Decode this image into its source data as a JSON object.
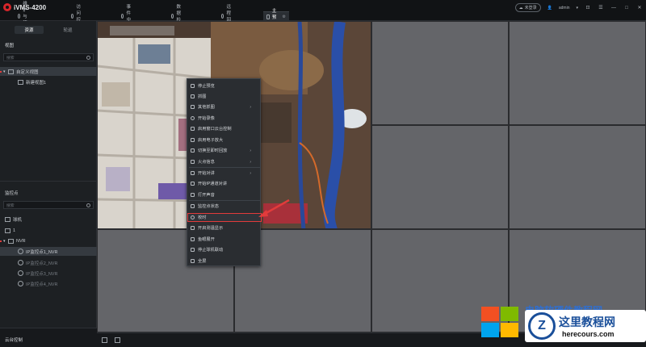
{
  "app": {
    "title": "iVMS-4200"
  },
  "nav_tabs": [
    {
      "label": "维护与管理"
    },
    {
      "label": "访问控制"
    },
    {
      "label": "事件中心"
    },
    {
      "label": "数据检索"
    },
    {
      "label": "远程回放"
    },
    {
      "label": "主预览"
    }
  ],
  "header": {
    "login_status": "未登录",
    "user": "admin"
  },
  "left_panel": {
    "tabs": [
      {
        "label": "资源"
      },
      {
        "label": "轮巡"
      }
    ],
    "views_title": "视图",
    "views_search_placeholder": "搜索",
    "views_tree": [
      {
        "label": "自定义视图"
      },
      {
        "label": "新建视图1"
      }
    ],
    "points_title": "监控点",
    "points_search_placeholder": "搜索",
    "points_tree": [
      {
        "label": "球机"
      },
      {
        "label": "1"
      },
      {
        "label": "NVR"
      },
      {
        "label": "IP监控点1_NVR"
      },
      {
        "label": "IP监控点2_NVR"
      },
      {
        "label": "IP监控点3_NVR"
      },
      {
        "label": "IP监控点4_NVR"
      }
    ],
    "ptz_title": "云台控制"
  },
  "context_menu": [
    {
      "label": "停止预览",
      "submenu": false
    },
    {
      "label": "抓图",
      "submenu": false
    },
    {
      "label": "其他抓图",
      "submenu": true
    },
    {
      "label": "开始录像",
      "submenu": false
    },
    {
      "label": "启用窗口云台控制",
      "submenu": false
    },
    {
      "label": "启用电子放大",
      "submenu": false
    },
    {
      "label": "切换至即时回放",
      "submenu": true
    },
    {
      "label": "火点信息",
      "submenu": true
    },
    {
      "label": "开始对讲",
      "submenu": true
    },
    {
      "label": "开始IP通道对讲",
      "submenu": false
    },
    {
      "label": "打开声音",
      "submenu": false
    },
    {
      "label": "监控点状态",
      "submenu": false
    },
    {
      "label": "校时",
      "submenu": false
    },
    {
      "label": "开启测温显示",
      "submenu": false
    },
    {
      "label": "鱼眼展开",
      "submenu": false
    },
    {
      "label": "停止球机联动",
      "submenu": false
    },
    {
      "label": "全屏",
      "submenu": false
    }
  ],
  "watermark": {
    "site_title": "这里教程网",
    "site_url": "herecours.com",
    "overlay_text": "电脑软硬件教程网"
  },
  "colors": {
    "accent_red": "#e23b3b",
    "grid_cell": "#646569",
    "watermark_blue": "#1a4f9a"
  }
}
